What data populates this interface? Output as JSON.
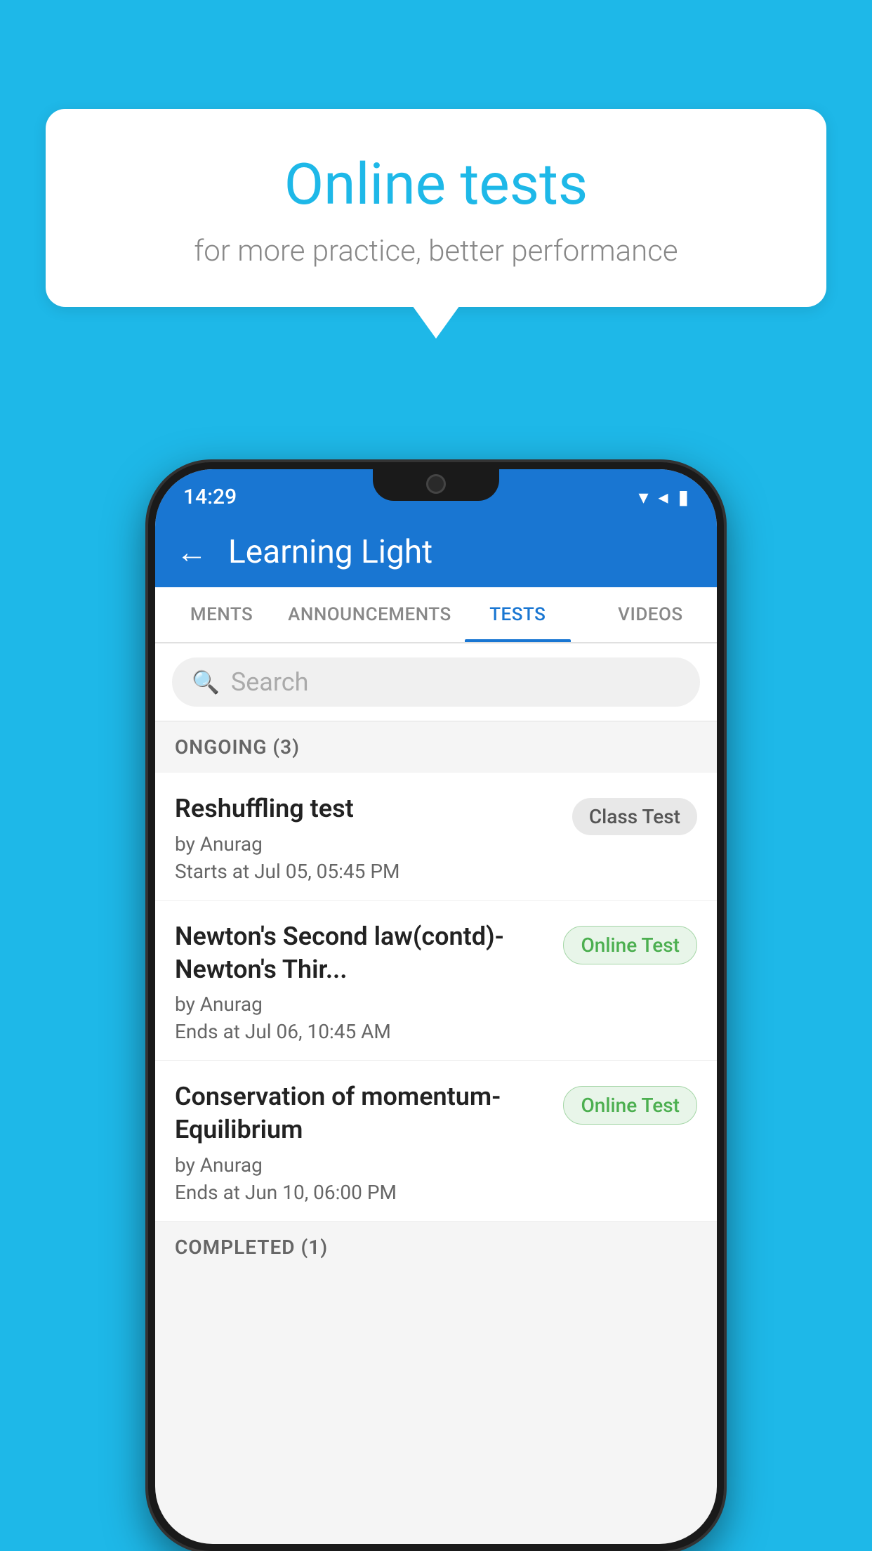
{
  "background_color": "#1eb8e8",
  "speech_bubble": {
    "title": "Online tests",
    "subtitle": "for more practice, better performance"
  },
  "phone": {
    "status_bar": {
      "time": "14:29",
      "icons": [
        "wifi",
        "signal",
        "battery"
      ]
    },
    "app_bar": {
      "title": "Learning Light",
      "back_label": "←"
    },
    "tabs": [
      {
        "label": "MENTS",
        "active": false
      },
      {
        "label": "ANNOUNCEMENTS",
        "active": false
      },
      {
        "label": "TESTS",
        "active": true
      },
      {
        "label": "VIDEOS",
        "active": false
      }
    ],
    "search": {
      "placeholder": "Search"
    },
    "ongoing_section": {
      "label": "ONGOING (3)"
    },
    "tests": [
      {
        "name": "Reshuffling test",
        "author": "by Anurag",
        "date_label": "Starts at",
        "date": "Jul 05, 05:45 PM",
        "badge": "Class Test",
        "badge_type": "class"
      },
      {
        "name": "Newton's Second law(contd)-Newton's Thir...",
        "author": "by Anurag",
        "date_label": "Ends at",
        "date": "Jul 06, 10:45 AM",
        "badge": "Online Test",
        "badge_type": "online"
      },
      {
        "name": "Conservation of momentum-Equilibrium",
        "author": "by Anurag",
        "date_label": "Ends at",
        "date": "Jun 10, 06:00 PM",
        "badge": "Online Test",
        "badge_type": "online"
      }
    ],
    "completed_section": {
      "label": "COMPLETED (1)"
    }
  }
}
